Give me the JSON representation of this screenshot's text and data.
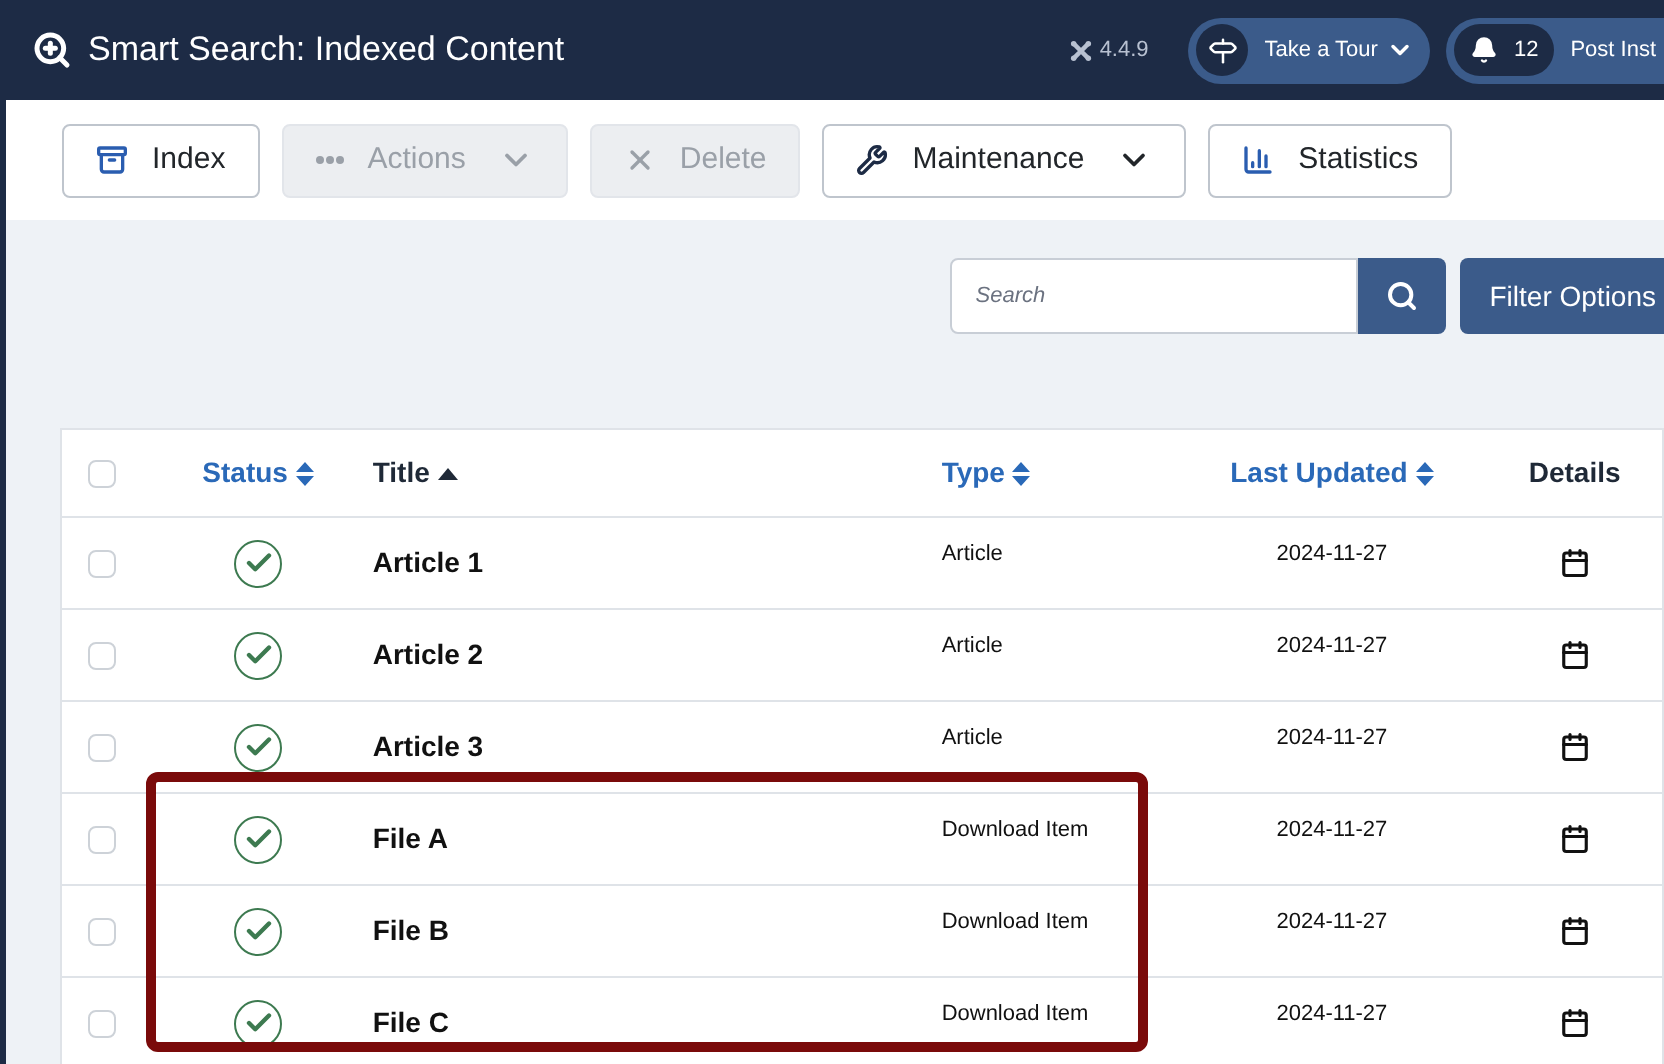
{
  "header": {
    "title": "Smart Search: Indexed Content",
    "version": "4.4.9",
    "tour_button": "Take a Tour",
    "notifications": {
      "count": "12",
      "label": "Post Inst"
    }
  },
  "toolbar": [
    {
      "kind": "button",
      "label": "Index",
      "disabled": false
    },
    {
      "kind": "dropdown",
      "label": "Actions",
      "disabled": true
    },
    {
      "kind": "button",
      "label": "Delete",
      "disabled": true
    },
    {
      "kind": "dropdown",
      "label": "Maintenance",
      "disabled": false
    },
    {
      "kind": "button",
      "label": "Statistics",
      "disabled": false
    }
  ],
  "search": {
    "placeholder": "Search",
    "filter_button": "Filter Options"
  },
  "table": {
    "select_all": {
      "checked": false
    },
    "columns": [
      {
        "label": "Status",
        "sortable": true,
        "sorted": false
      },
      {
        "label": "Title",
        "sortable": true,
        "sorted": true
      },
      {
        "label": "Type",
        "sortable": true,
        "sorted": false
      },
      {
        "label": "Last Updated",
        "sortable": true,
        "sorted": false
      },
      {
        "label": "Details",
        "sortable": false,
        "sorted": false
      }
    ],
    "rows": [
      {
        "checked": false,
        "published": true,
        "title": "Article 1",
        "type": "Article",
        "updated": "2024-11-27"
      },
      {
        "checked": false,
        "published": true,
        "title": "Article 2",
        "type": "Article",
        "updated": "2024-11-27"
      },
      {
        "checked": false,
        "published": true,
        "title": "Article 3",
        "type": "Article",
        "updated": "2024-11-27"
      },
      {
        "checked": false,
        "published": true,
        "title": "File A",
        "type": "Download Item",
        "updated": "2024-11-27"
      },
      {
        "checked": false,
        "published": true,
        "title": "File B",
        "type": "Download Item",
        "updated": "2024-11-27"
      },
      {
        "checked": false,
        "published": true,
        "title": "File C",
        "type": "Download Item",
        "updated": "2024-11-27"
      }
    ]
  }
}
